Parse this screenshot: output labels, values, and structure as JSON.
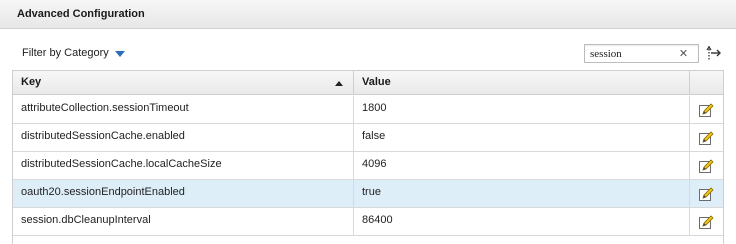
{
  "panel": {
    "title": "Advanced Configuration"
  },
  "toolbar": {
    "filter_label": "Filter by Category",
    "search_value": "session",
    "clear_icon": "close-icon",
    "export_icon": "export-arrows-icon"
  },
  "table": {
    "columns": {
      "key": "Key",
      "value": "Value"
    },
    "sort": {
      "column": "Key",
      "direction": "ascending"
    },
    "rows": [
      {
        "key": "attributeCollection.sessionTimeout",
        "value": "1800",
        "selected": false
      },
      {
        "key": "distributedSessionCache.enabled",
        "value": "false",
        "selected": false
      },
      {
        "key": "distributedSessionCache.localCacheSize",
        "value": "4096",
        "selected": false
      },
      {
        "key": "oauth20.sessionEndpointEnabled",
        "value": "true",
        "selected": true
      },
      {
        "key": "session.dbCleanupInterval",
        "value": "86400",
        "selected": false
      }
    ],
    "row_action_icon": "edit-icon"
  },
  "colors": {
    "accent": "#2a6ebb",
    "selected_row": "#ddeef8",
    "header_bg": "#ececec",
    "border": "#cfcfcf"
  }
}
